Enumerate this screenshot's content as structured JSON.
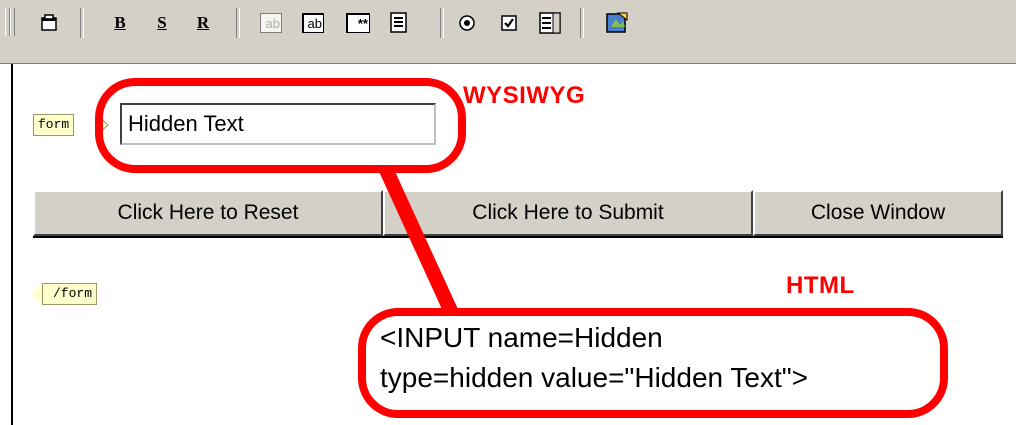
{
  "toolbar": {
    "icons": [
      "page-icon",
      "bold-icon",
      "strike-icon",
      "regular-icon",
      "disabled-textbox-icon",
      "textbox-icon",
      "password-field-icon",
      "textarea-icon",
      "radio-button-icon",
      "checkbox-icon",
      "listbox-icon",
      "image-button-icon"
    ],
    "bold_label": "B",
    "strike_label": "S",
    "r_label": "R",
    "textbox_label": "ab",
    "disabled_textbox_label": "ab",
    "password_label": "**"
  },
  "editor": {
    "form_open_tag": "form",
    "hidden_input_value": "Hidden Text",
    "buttons": {
      "reset": "Click Here to Reset",
      "submit": "Click Here to Submit",
      "close": "Close Window"
    },
    "form_close_tag": "/form"
  },
  "annotations": {
    "wysiwyg_label": "WYSIWYG",
    "html_label": "HTML",
    "code_line1": "<INPUT name=Hidden",
    "code_line2": "type=hidden value=\"Hidden Text\">",
    "color": "#ff0000"
  }
}
